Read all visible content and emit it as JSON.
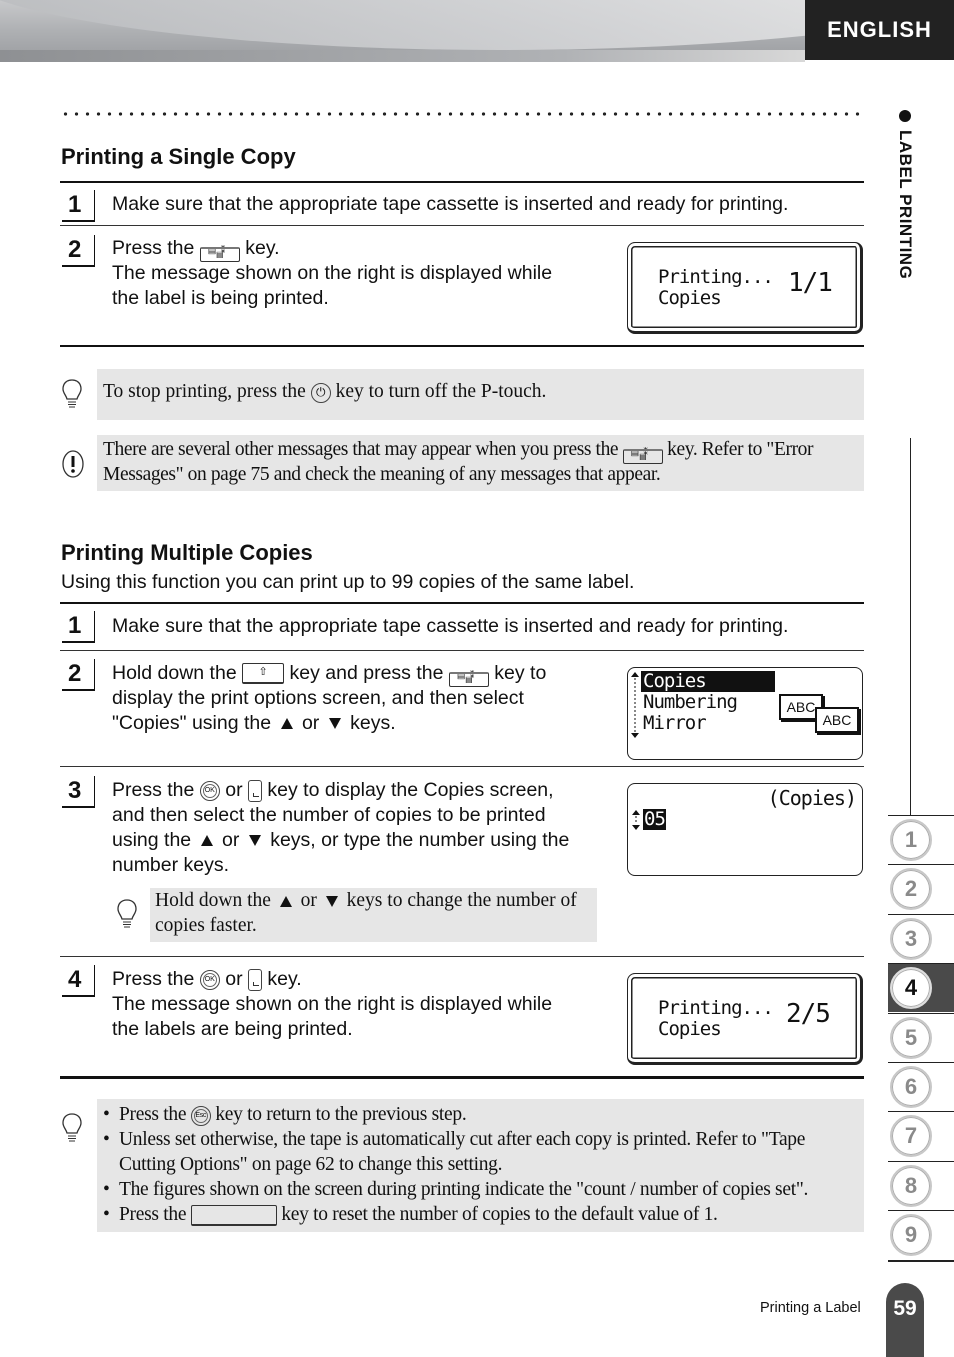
{
  "header": {
    "language_tab": "ENGLISH"
  },
  "side": {
    "section_label": "LABEL PRINTING",
    "chapters": [
      "1",
      "2",
      "3",
      "4",
      "5",
      "6",
      "7",
      "8",
      "9"
    ],
    "active_chapter": "4"
  },
  "single_copy": {
    "title": "Printing a Single Copy",
    "steps": [
      {
        "num": "1",
        "text": "Make sure that the appropriate tape cassette is inserted and ready for printing."
      },
      {
        "num": "2",
        "line1_pre": "Press the",
        "line1_post": "key.",
        "line2": "The message shown on the right is displayed while",
        "line3": "the label is being printed."
      }
    ],
    "lcd": {
      "line1": "Printing...",
      "line2": "Copies",
      "count": "1/1"
    }
  },
  "notes_single": {
    "tip": {
      "pre": "To stop printing, press the",
      "post": "key to turn off the P-touch."
    },
    "caution": {
      "pre": "There are several other messages that may appear when you press the",
      "post": "key. Refer to \"Error",
      "line2": "Messages\" on page 75 and check the meaning of any messages that appear."
    }
  },
  "multiple_copies": {
    "title": "Printing Multiple Copies",
    "intro": "Using this function you can print up to 99 copies of the same label.",
    "step1": {
      "num": "1",
      "text": "Make sure that the appropriate tape cassette is inserted and ready for printing."
    },
    "step2": {
      "num": "2",
      "a": "Hold down the",
      "b": "key and press the",
      "c": "key to",
      "line2": "display the print options screen, and then select",
      "line3_pre": "\"Copies\" using the",
      "or": "or",
      "line3_post": "keys."
    },
    "step2_lcd": {
      "items": [
        "Copies",
        "Numbering",
        "Mirror"
      ],
      "selected": "Copies",
      "icon_text": "ABC"
    },
    "step3": {
      "num": "3",
      "a": "Press the",
      "or": "or",
      "b": "key to display the Copies screen,",
      "line2": "and then select the number of copies to be printed",
      "line3_pre": "using the",
      "line3_post": "keys, or type the number using the",
      "line4": "number keys."
    },
    "step3_lcd": {
      "title": "(Copies)",
      "value": "05"
    },
    "step3_tip": {
      "pre": "Hold down the",
      "or": "or",
      "post": "keys to change the number of",
      "line2": "copies faster."
    },
    "step4": {
      "num": "4",
      "a": "Press the",
      "or": "or",
      "b": "key.",
      "line2": "The message shown on the right is displayed while",
      "line3": "the labels are being printed."
    },
    "step4_lcd": {
      "line1": "Printing...",
      "line2": "Copies",
      "count": "2/5"
    }
  },
  "final_notes": {
    "items": [
      {
        "pre": "Press the",
        "post": "key to return to the previous step."
      },
      {
        "text": "Unless set otherwise, the tape is automatically cut after each copy is printed. Refer to \"Tape Cutting Options\" on page 62 to change this setting."
      },
      {
        "text": "The figures shown on the screen during printing indicate the \"count / number of copies set\"."
      },
      {
        "pre": "Press the",
        "post": "key to reset the number of copies to the default value of 1."
      }
    ]
  },
  "footer": {
    "section": "Printing a Label",
    "page": "59"
  },
  "keys": {
    "ok": "OK",
    "esc": "Esc",
    "power": "⏻",
    "shift": "⇧",
    "print_top": "▤ ⁑",
    "print_box": "▤"
  }
}
